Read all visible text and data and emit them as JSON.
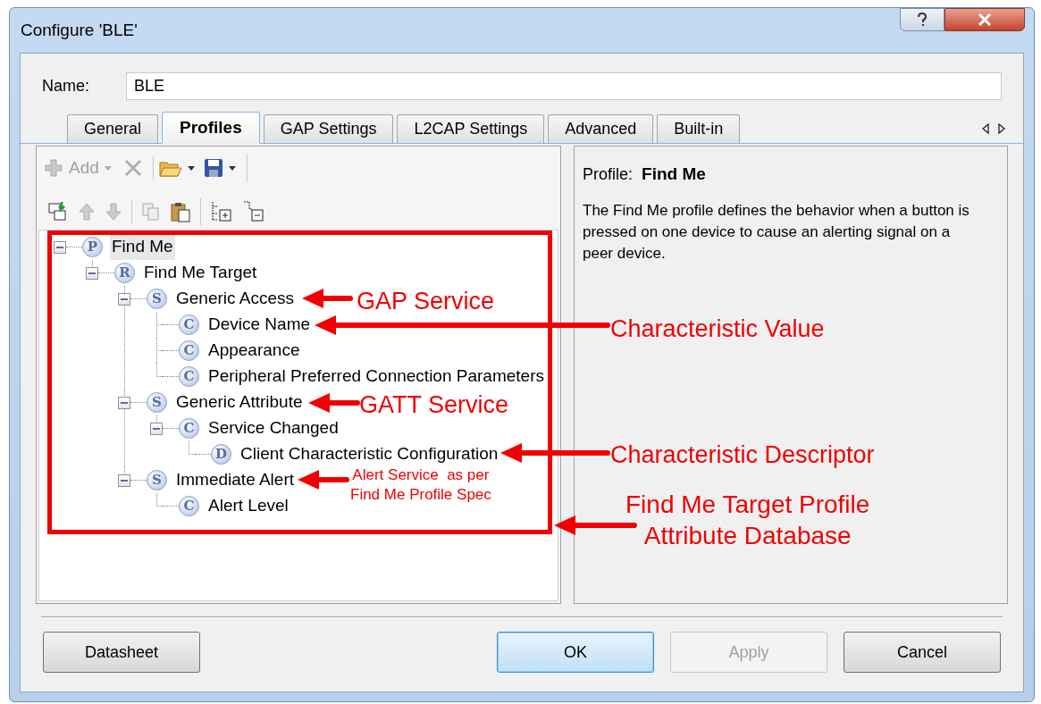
{
  "window": {
    "title": "Configure 'BLE'"
  },
  "name_field": {
    "label": "Name:",
    "value": "BLE"
  },
  "tabs": [
    {
      "label": "General",
      "selected": false
    },
    {
      "label": "Profiles",
      "selected": true
    },
    {
      "label": "GAP Settings",
      "selected": false
    },
    {
      "label": "L2CAP Settings",
      "selected": false
    },
    {
      "label": "Advanced",
      "selected": false
    },
    {
      "label": "Built-in",
      "selected": false
    }
  ],
  "toolbar": {
    "add": {
      "label": "Add",
      "disabled": true
    }
  },
  "tree": [
    {
      "letter": "P",
      "label": "Find Me",
      "selected": true,
      "expanded": true,
      "children": [
        {
          "letter": "R",
          "label": "Find Me Target",
          "selected": false,
          "expanded": true,
          "children": [
            {
              "letter": "S",
              "label": "Generic Access",
              "selected": false,
              "expanded": true,
              "children": [
                {
                  "letter": "C",
                  "label": "Device Name",
                  "selected": false
                },
                {
                  "letter": "C",
                  "label": "Appearance",
                  "selected": false
                },
                {
                  "letter": "C",
                  "label": "Peripheral Preferred Connection Parameters",
                  "selected": false
                }
              ]
            },
            {
              "letter": "S",
              "label": "Generic Attribute",
              "selected": false,
              "expanded": true,
              "children": [
                {
                  "letter": "C",
                  "label": "Service Changed",
                  "selected": false,
                  "expanded": true,
                  "children": [
                    {
                      "letter": "D",
                      "label": "Client Characteristic Configuration",
                      "selected": false
                    }
                  ]
                }
              ]
            },
            {
              "letter": "S",
              "label": "Immediate Alert",
              "selected": false,
              "expanded": true,
              "children": [
                {
                  "letter": "C",
                  "label": "Alert Level",
                  "selected": false
                }
              ]
            }
          ]
        }
      ]
    }
  ],
  "details": {
    "label": "Profile:",
    "value": "Find Me",
    "description": "The Find Me profile defines the behavior when a button is pressed on one device to cause an alerting signal on a peer device."
  },
  "buttons": [
    {
      "label": "Datasheet",
      "disabled": false,
      "default": false
    },
    {
      "label": "OK",
      "disabled": false,
      "default": true
    },
    {
      "label": "Apply",
      "disabled": true,
      "default": false
    },
    {
      "label": "Cancel",
      "disabled": false,
      "default": false
    }
  ],
  "annotations": [
    {
      "lines": [
        "GAP Service"
      ]
    },
    {
      "lines": [
        "Characteristic Value"
      ]
    },
    {
      "lines": [
        "GATT Service"
      ]
    },
    {
      "lines": [
        "Characteristic Descriptor"
      ]
    },
    {
      "lines": [
        "Alert Service  as per",
        "Find Me Profile Spec"
      ]
    },
    {
      "lines": [
        "Find Me Target Profile",
        "Attribute Database"
      ]
    }
  ]
}
